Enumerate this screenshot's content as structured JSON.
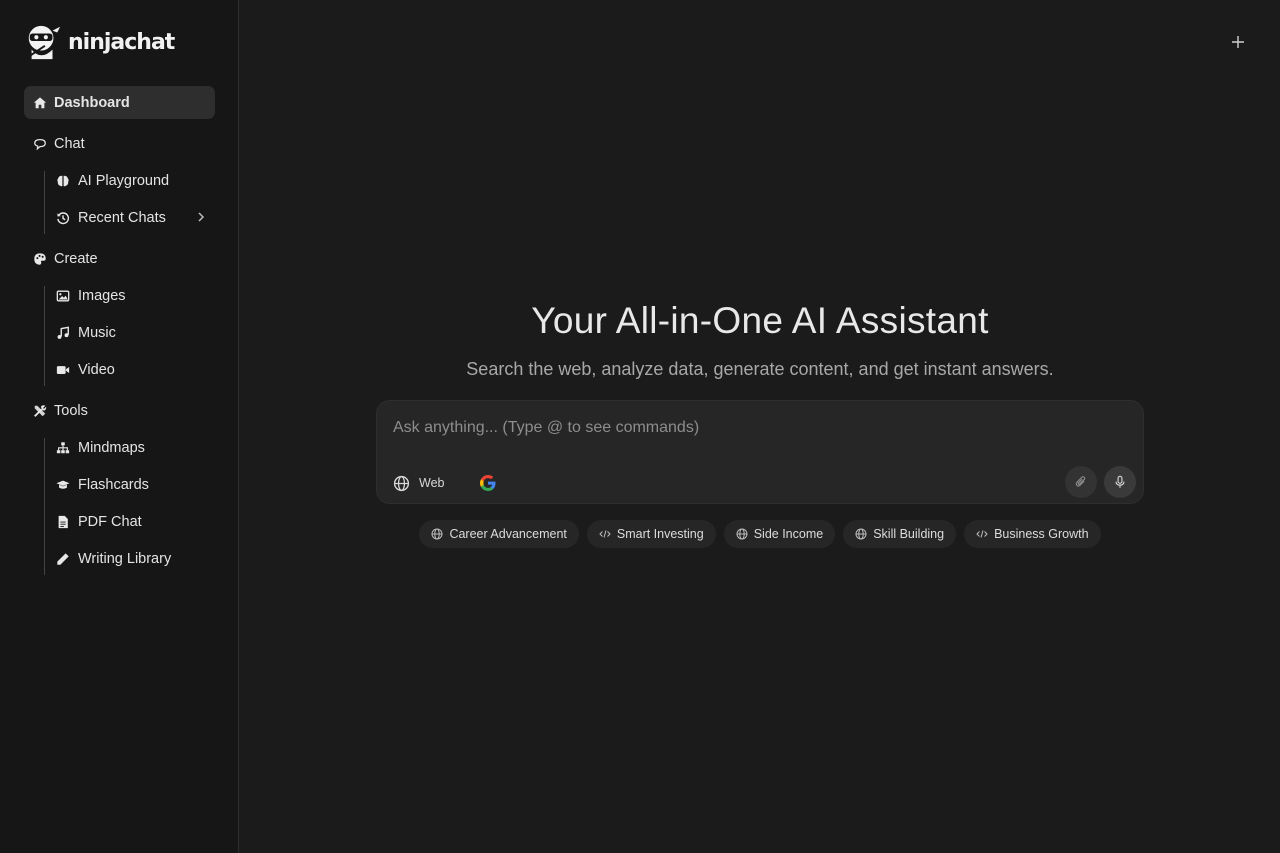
{
  "brand": {
    "name": "ninjachat"
  },
  "sidebar": {
    "dashboard": "Dashboard",
    "chat": {
      "label": "Chat",
      "items": [
        {
          "label": "AI Playground",
          "icon": "brain-icon"
        },
        {
          "label": "Recent Chats",
          "icon": "history-icon"
        }
      ]
    },
    "create": {
      "label": "Create",
      "items": [
        {
          "label": "Images",
          "icon": "image-icon"
        },
        {
          "label": "Music",
          "icon": "music-icon"
        },
        {
          "label": "Video",
          "icon": "video-icon"
        }
      ]
    },
    "tools": {
      "label": "Tools",
      "items": [
        {
          "label": "Mindmaps",
          "icon": "sitemap-icon"
        },
        {
          "label": "Flashcards",
          "icon": "graduation-cap-icon"
        },
        {
          "label": "PDF Chat",
          "icon": "file-icon"
        },
        {
          "label": "Writing Library",
          "icon": "pencil-icon"
        }
      ]
    }
  },
  "main": {
    "title": "Your All-in-One AI Assistant",
    "subtitle": "Search the web, analyze data, generate content, and get instant answers.",
    "composer": {
      "placeholder": "Ask anything... (Type @ to see commands)",
      "web_label": "Web"
    },
    "suggestions": [
      {
        "label": "Career Advancement",
        "icon": "globe-icon"
      },
      {
        "label": "Smart Investing",
        "icon": "code-icon"
      },
      {
        "label": "Side Income",
        "icon": "globe-icon"
      },
      {
        "label": "Skill Building",
        "icon": "globe-icon"
      },
      {
        "label": "Business Growth",
        "icon": "code-icon"
      }
    ]
  },
  "colors": {
    "background": "#1b1b1b",
    "sidebar": "#161616",
    "active_item": "#2e2e2e",
    "composer": "#262626"
  }
}
